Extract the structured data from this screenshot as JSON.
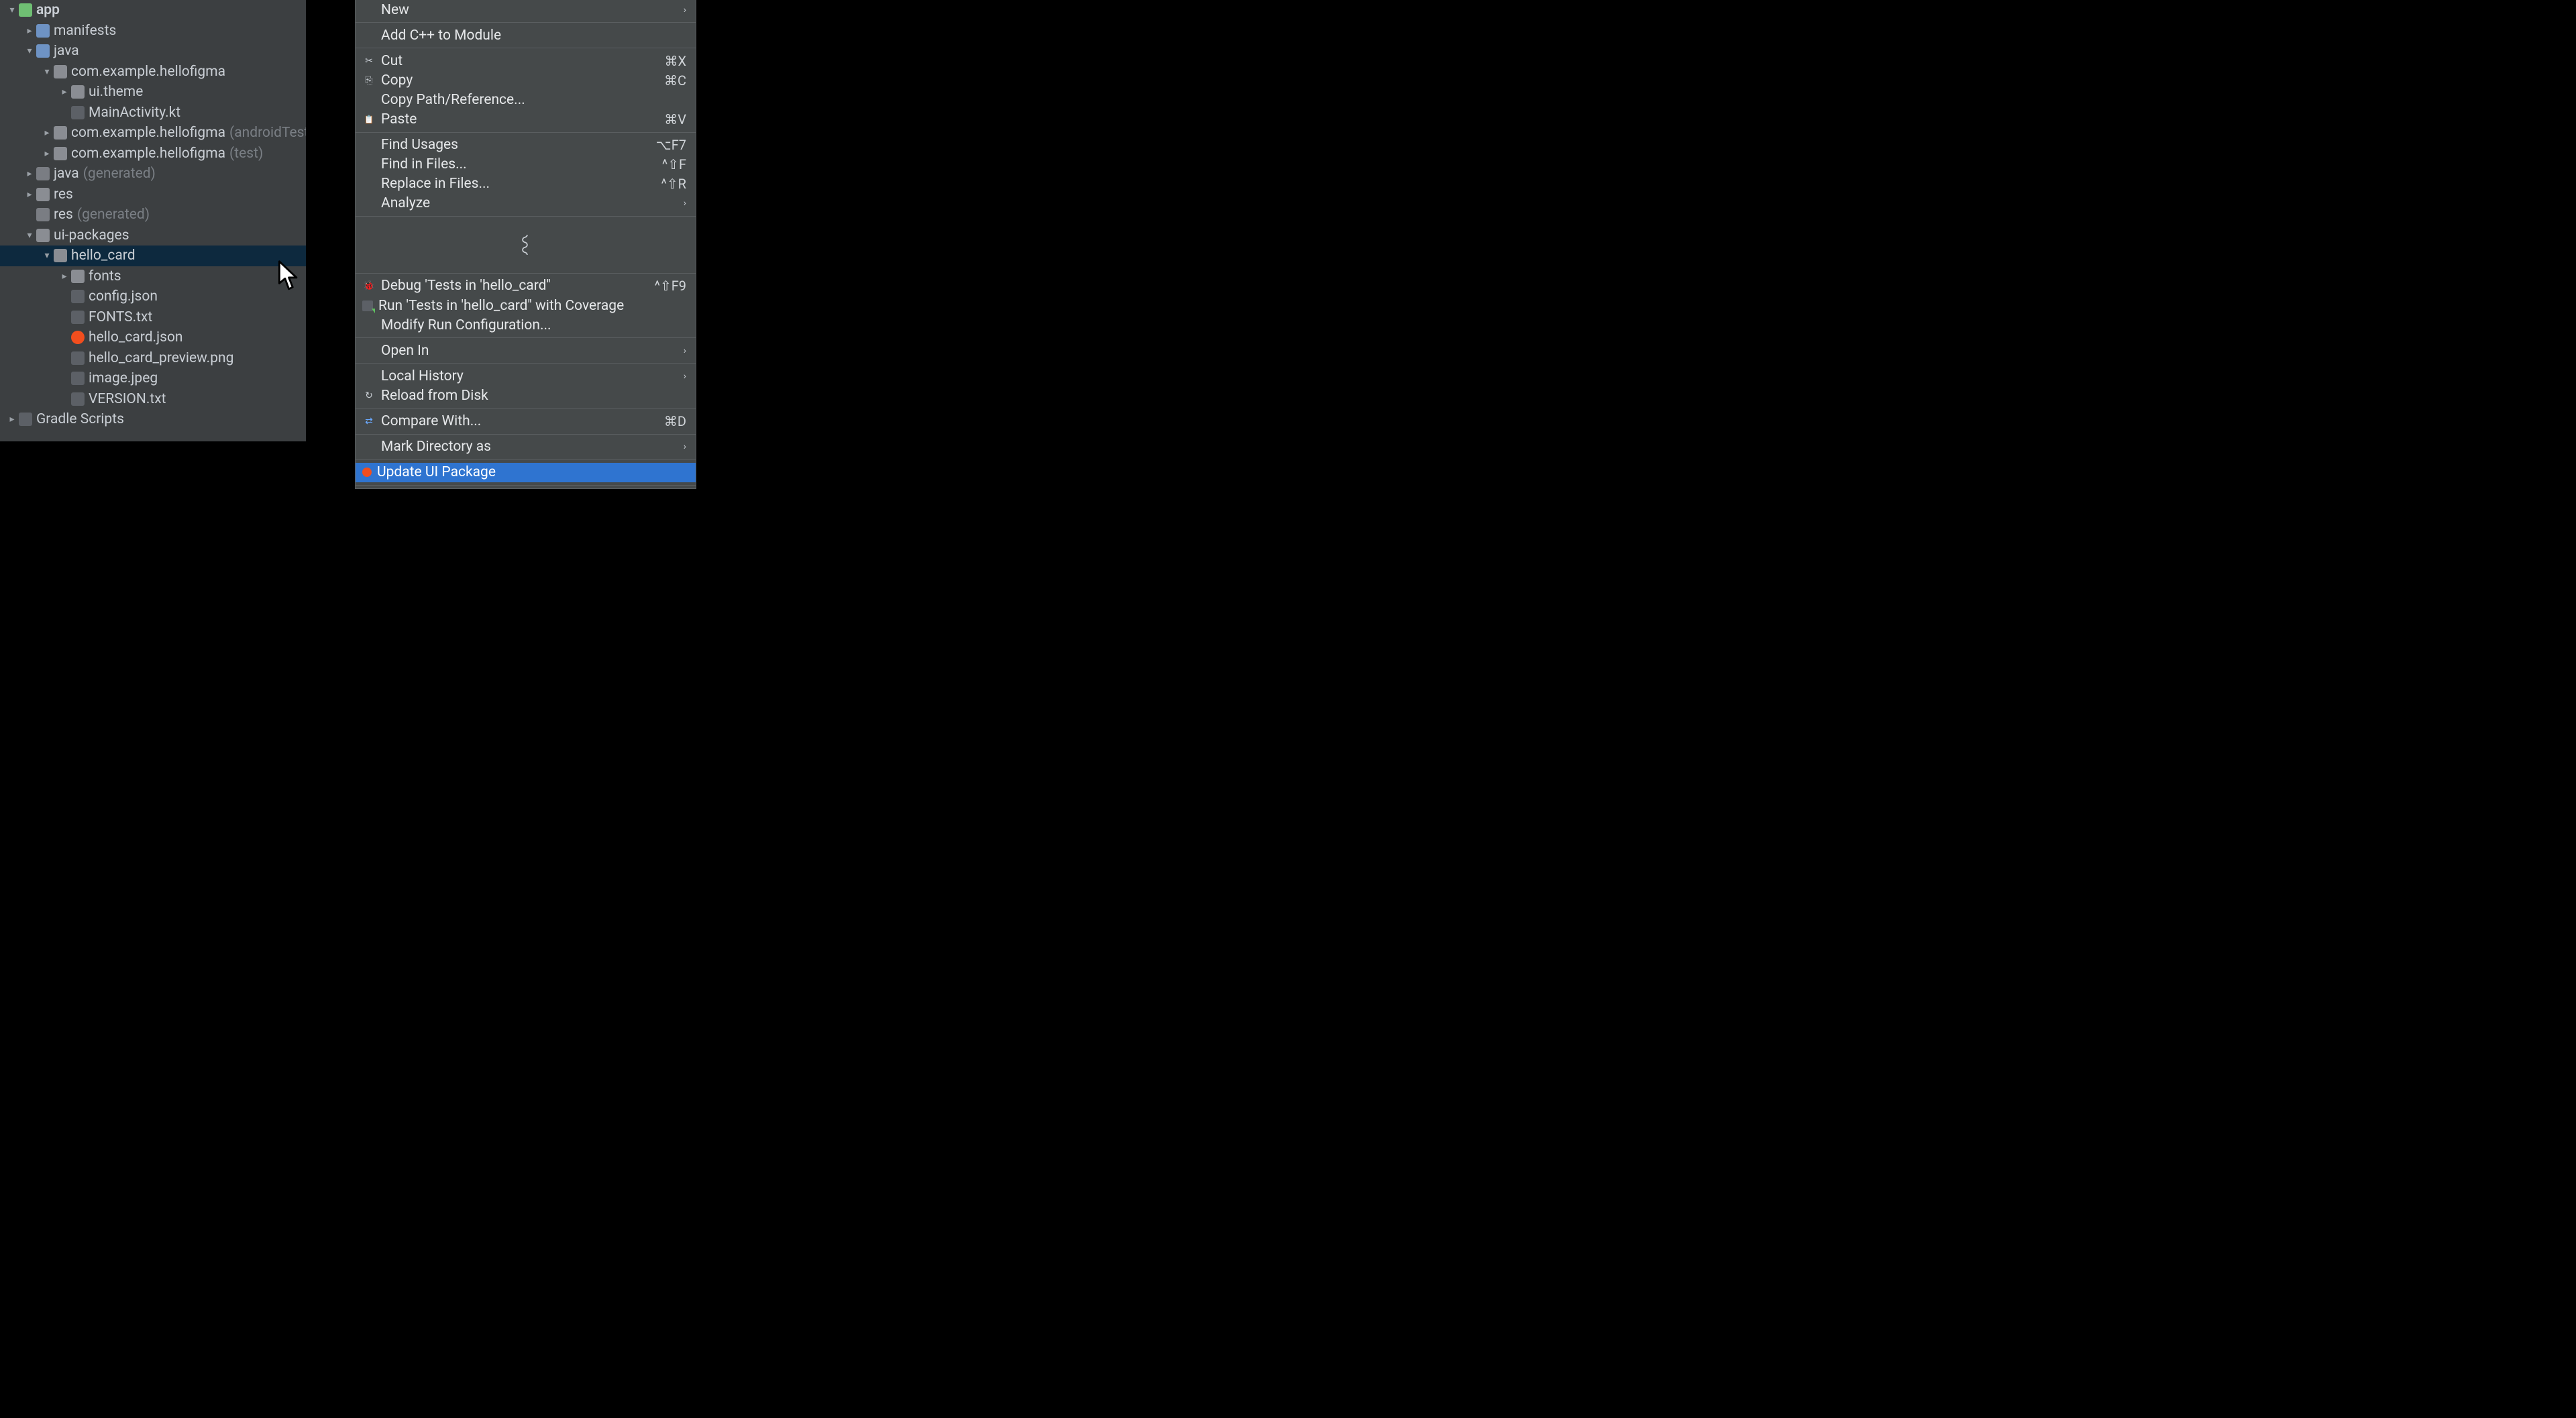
{
  "tree": [
    {
      "chevron": "down",
      "indent": 8,
      "icon": "ic-module",
      "label": "app",
      "bold": true
    },
    {
      "chevron": "right",
      "indent": 34,
      "icon": "ic-folder",
      "label": "manifests"
    },
    {
      "chevron": "down",
      "indent": 34,
      "icon": "ic-folder",
      "label": "java"
    },
    {
      "chevron": "down",
      "indent": 60,
      "icon": "ic-pkg",
      "label": "com.example.hellofigma"
    },
    {
      "chevron": "right",
      "indent": 86,
      "icon": "ic-pkg",
      "label": "ui.theme"
    },
    {
      "chevron": "",
      "indent": 86,
      "icon": "ic-ktfile",
      "label": "MainActivity.kt",
      "file": true
    },
    {
      "chevron": "right",
      "indent": 60,
      "icon": "ic-pkg",
      "label": "com.example.hellofigma",
      "aux": "(androidTest)"
    },
    {
      "chevron": "right",
      "indent": 60,
      "icon": "ic-pkg",
      "label": "com.example.hellofigma",
      "aux": "(test)"
    },
    {
      "chevron": "right",
      "indent": 34,
      "icon": "ic-gen",
      "label": "java",
      "aux": "(generated)"
    },
    {
      "chevron": "right",
      "indent": 34,
      "icon": "ic-res",
      "label": "res"
    },
    {
      "chevron": "",
      "indent": 34,
      "icon": "ic-gen",
      "label": "res",
      "aux": "(generated)",
      "file": true
    },
    {
      "chevron": "down",
      "indent": 34,
      "icon": "ic-uipkg",
      "label": "ui-packages"
    },
    {
      "chevron": "down",
      "indent": 60,
      "icon": "ic-pkg",
      "label": "hello_card",
      "selected": true
    },
    {
      "chevron": "right",
      "indent": 86,
      "icon": "ic-pkg",
      "label": "fonts"
    },
    {
      "chevron": "",
      "indent": 86,
      "icon": "ic-json",
      "label": "config.json",
      "file": true
    },
    {
      "chevron": "",
      "indent": 86,
      "icon": "ic-txt",
      "label": "FONTS.txt",
      "file": true
    },
    {
      "chevron": "",
      "indent": 86,
      "icon": "ic-figma",
      "label": "hello_card.json",
      "file": true
    },
    {
      "chevron": "",
      "indent": 86,
      "icon": "ic-img",
      "label": "hello_card_preview.png",
      "file": true
    },
    {
      "chevron": "",
      "indent": 86,
      "icon": "ic-img",
      "label": "image.jpeg",
      "file": true
    },
    {
      "chevron": "",
      "indent": 86,
      "icon": "ic-txt",
      "label": "VERSION.txt",
      "file": true
    },
    {
      "chevron": "right",
      "indent": 8,
      "icon": "ic-gradle",
      "label": "Gradle Scripts"
    }
  ],
  "menu": [
    {
      "type": "item",
      "label": "New",
      "submenu": true
    },
    {
      "type": "sep"
    },
    {
      "type": "item",
      "label": "Add C++ to Module"
    },
    {
      "type": "sep"
    },
    {
      "type": "item",
      "icon": "mi-cut",
      "label": "Cut",
      "shortcut": "⌘X"
    },
    {
      "type": "item",
      "icon": "mi-copy",
      "label": "Copy",
      "shortcut": "⌘C"
    },
    {
      "type": "item",
      "label": "Copy Path/Reference..."
    },
    {
      "type": "item",
      "icon": "mi-paste",
      "label": "Paste",
      "shortcut": "⌘V"
    },
    {
      "type": "sep"
    },
    {
      "type": "item",
      "label": "Find Usages",
      "shortcut": "⌥F7"
    },
    {
      "type": "item",
      "label": "Find in Files...",
      "shortcut": "^⇧F"
    },
    {
      "type": "item",
      "label": "Replace in Files...",
      "shortcut": "^⇧R"
    },
    {
      "type": "item",
      "label": "Analyze",
      "submenu": true
    },
    {
      "type": "sep"
    },
    {
      "type": "snip"
    },
    {
      "type": "sep"
    },
    {
      "type": "item",
      "icon": "mi-bug",
      "label": "Debug 'Tests in 'hello_card''",
      "shortcut": "^⇧F9"
    },
    {
      "type": "item",
      "icon": "mi-shield",
      "label": "Run 'Tests in 'hello_card'' with Coverage"
    },
    {
      "type": "item",
      "label": "Modify Run Configuration..."
    },
    {
      "type": "sep"
    },
    {
      "type": "item",
      "label": "Open In",
      "submenu": true
    },
    {
      "type": "sep"
    },
    {
      "type": "item",
      "label": "Local History",
      "submenu": true
    },
    {
      "type": "item",
      "icon": "mi-reload",
      "label": "Reload from Disk"
    },
    {
      "type": "sep"
    },
    {
      "type": "item",
      "icon": "mi-compare",
      "label": "Compare With...",
      "shortcut": "⌘D"
    },
    {
      "type": "sep"
    },
    {
      "type": "item",
      "label": "Mark Directory as",
      "submenu": true
    },
    {
      "type": "sep"
    },
    {
      "type": "item",
      "icon": "mi-figma",
      "label": "Update UI Package",
      "highlight": true
    },
    {
      "type": "sep"
    }
  ]
}
